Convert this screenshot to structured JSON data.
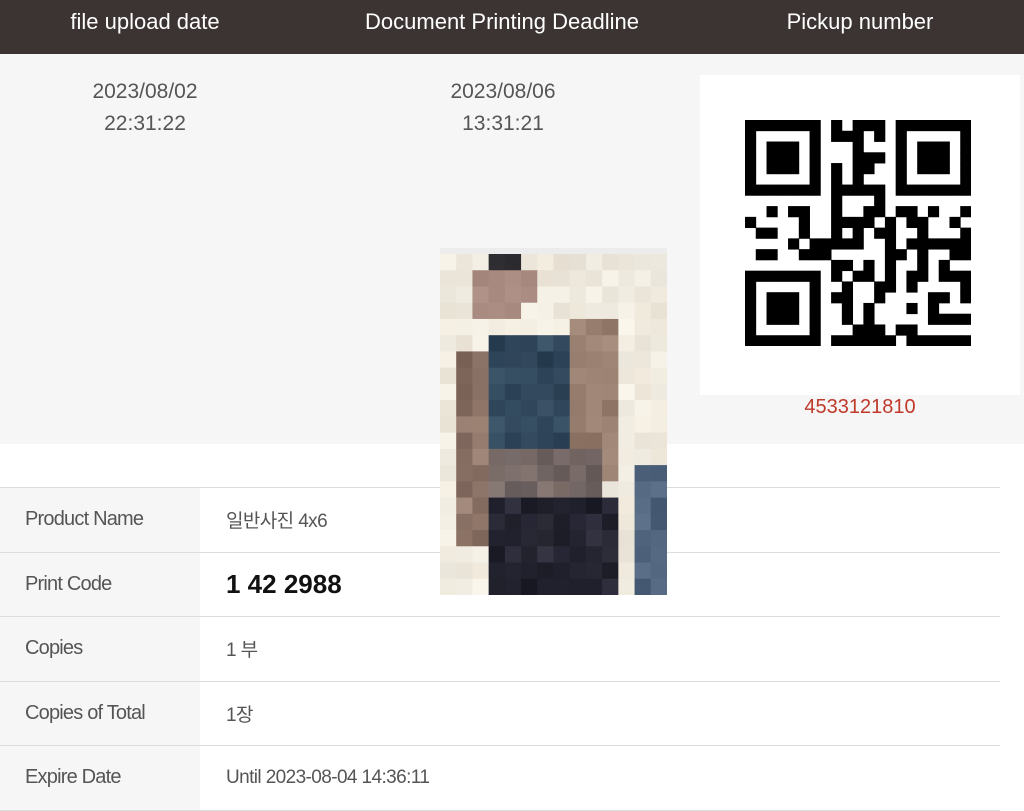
{
  "header": {
    "upload_label": "file upload date",
    "deadline_label": "Document Printing Deadline",
    "pickup_label": "Pickup number"
  },
  "upload": {
    "date": "2023/08/02",
    "time": "22:31:22"
  },
  "deadline": {
    "date": "2023/08/06",
    "time": "13:31:21"
  },
  "pickup": {
    "number": "4533121810",
    "icon": "qr-code-icon"
  },
  "details": {
    "product_name_label": "Product Name",
    "product_name_value": "일반사진 4x6",
    "print_code_label": "Print Code",
    "print_code_value": "1 42 2988",
    "copies_label": "Copies",
    "copies_value": "1 부",
    "copies_total_label": "Copies of Total",
    "copies_total_value": "1장",
    "expire_label": "Expire Date",
    "expire_value": "Until 2023-08-04 14:36:11"
  },
  "colors": {
    "header_bg": "#3b3432",
    "pickup_number": "#c0392b",
    "summary_bg": "#f6f6f6"
  }
}
